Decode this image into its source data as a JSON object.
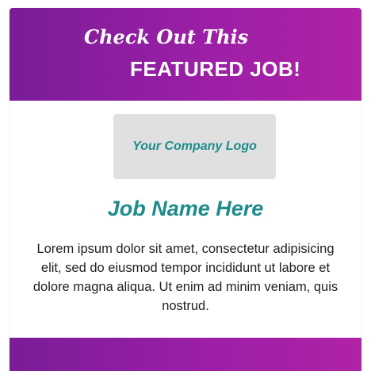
{
  "banner": {
    "script_text": "Check Out This",
    "heading": "FEATURED JOB!",
    "gradient_start": "#7a1d97",
    "gradient_end": "#b022a6"
  },
  "logo": {
    "placeholder_text": "Your Company Logo",
    "background": "#e0e0e0"
  },
  "job": {
    "title": "Job Name Here",
    "title_color": "#1e8c8a",
    "description": "Lorem ipsum dolor sit amet, consectetur adipisicing elit, sed do eiusmod tempor incididunt ut labore et dolore magna aliqua. Ut enim ad minim veniam, quis nostrud."
  }
}
